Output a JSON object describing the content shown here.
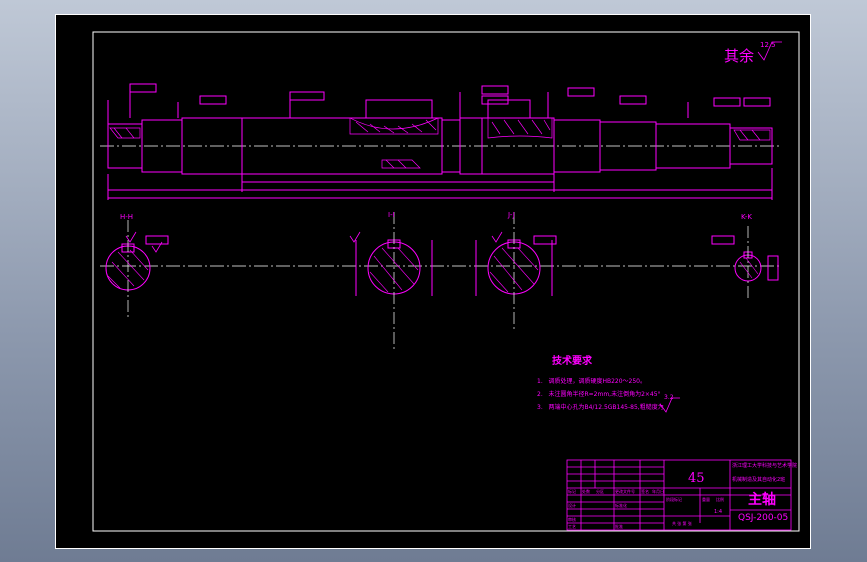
{
  "drawing": {
    "roughness_note": "其余",
    "roughness_value": "12.5",
    "section_labels": [
      "H-H",
      "I-I",
      "J-J",
      "K-K"
    ],
    "tech_req_title": "技术要求",
    "tech_requirements": [
      {
        "num": "1.",
        "text": "调质处理，调质硬度HB220～250。"
      },
      {
        "num": "2.",
        "text": "未注圆角半径R=2mm,未注倒角为2×45°"
      },
      {
        "num": "3.",
        "text": "两端中心孔为B4/12.5GB145-85,粗糙度为"
      }
    ],
    "tech_roughness": "3.2"
  },
  "title_block": {
    "material": "45",
    "school": "浙江理工大学科技与艺术学院",
    "school_line2": "机械制造及其自动化2班",
    "part_name": "主轴",
    "drawing_no": "QSJ-200-05",
    "scale": "1:4",
    "labels": [
      "标记",
      "处数",
      "分区",
      "更改文件号",
      "签名",
      "年月日",
      "设计",
      "标准化",
      "阶段标记",
      "重量",
      "比例",
      "审核",
      "工艺",
      "批准",
      "共 张 第 张"
    ]
  },
  "colors": {
    "line": "#ff00ff",
    "axis": "#ffffff",
    "frame": "#ffffff",
    "background": "#000000"
  }
}
